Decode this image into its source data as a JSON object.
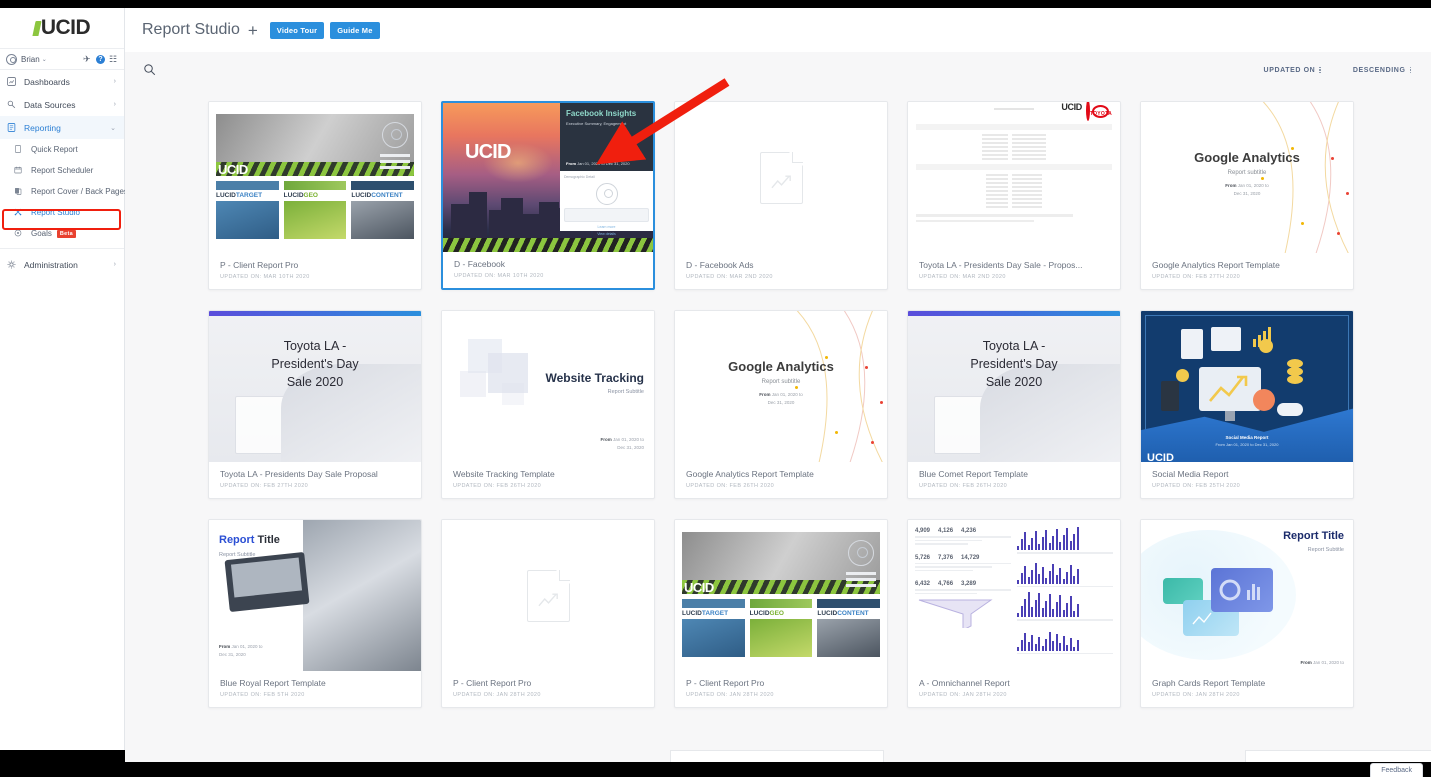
{
  "app": {
    "logo_text": "UCID",
    "logo_full": "LUCID"
  },
  "sidebar": {
    "user": {
      "name": "Brian",
      "caret": "⌄"
    },
    "icons": [
      {
        "name": "bell-icon",
        "glyph": "🔔"
      },
      {
        "name": "help-icon",
        "glyph": "?"
      },
      {
        "name": "apps-icon",
        "glyph": "⧉"
      }
    ],
    "items": [
      {
        "label": "Dashboards",
        "icon": "dashboard-icon",
        "chevron": "›",
        "active": false
      },
      {
        "label": "Data Sources",
        "icon": "data-sources-icon",
        "chevron": "›",
        "active": false
      },
      {
        "label": "Reporting",
        "icon": "reporting-icon",
        "chevron": "⌄",
        "active": true
      }
    ],
    "sub_items": [
      {
        "label": "Quick Report",
        "icon": "quick-report-icon"
      },
      {
        "label": "Report Scheduler",
        "icon": "calendar-icon"
      },
      {
        "label": "Report Cover / Back Pages",
        "icon": "cover-pages-icon"
      },
      {
        "label": "Report Studio",
        "icon": "report-studio-icon",
        "highlighted": true
      },
      {
        "label": "Goals",
        "icon": "goals-icon",
        "badge": "Beta"
      }
    ],
    "admin": {
      "label": "Administration",
      "icon": "gear-icon",
      "chevron": "›"
    }
  },
  "header": {
    "title": "Report Studio",
    "add_label": "+",
    "buttons": [
      {
        "label": "Video Tour",
        "name": "video-tour-button"
      },
      {
        "label": "Guide Me",
        "name": "guide-me-button"
      }
    ]
  },
  "toolbar": {
    "search_icon": "search-icon",
    "sort_by": "UPDATED ON",
    "sort_dir": "DESCENDING"
  },
  "cards": [
    {
      "title": "P - Client Report Pro",
      "date": "UPDATED ON: MAR 10TH 2020",
      "art": "client-report-pro",
      "selected": false
    },
    {
      "title": "D - Facebook",
      "date": "UPDATED ON: MAR 10TH 2020",
      "art": "facebook",
      "selected": true
    },
    {
      "title": "D - Facebook Ads",
      "date": "UPDATED ON: MAR 2ND 2020",
      "art": "blank-doc",
      "selected": false
    },
    {
      "title": "Toyota LA - Presidents Day Sale - Propos...",
      "date": "UPDATED ON: MAR 2ND 2020",
      "art": "toyota-doc",
      "selected": false
    },
    {
      "title": "Google Analytics Report Template",
      "date": "UPDATED ON: FEB 27TH 2020",
      "art": "google-analytics",
      "selected": false
    },
    {
      "title": "Toyota LA - Presidents Day Sale Proposal",
      "date": "UPDATED ON: FEB 27TH 2020",
      "art": "toyota-la",
      "selected": false
    },
    {
      "title": "Website Tracking Template",
      "date": "UPDATED ON: FEB 26TH 2020",
      "art": "website-tracking",
      "selected": false
    },
    {
      "title": "Google Analytics Report Template",
      "date": "UPDATED ON: FEB 26TH 2020",
      "art": "google-analytics",
      "selected": false
    },
    {
      "title": "Blue Comet Report Template",
      "date": "UPDATED ON: FEB 26TH 2020",
      "art": "toyota-la",
      "selected": false
    },
    {
      "title": "Social Media Report",
      "date": "UPDATED ON: FEB 25TH 2020",
      "art": "social-media",
      "selected": false
    },
    {
      "title": "Blue Royal Report Template",
      "date": "UPDATED ON: FEB 5TH 2020",
      "art": "blue-royal",
      "selected": false
    },
    {
      "title": "P - Client Report Pro",
      "date": "UPDATED ON: JAN 28TH 2020",
      "art": "blank-doc",
      "selected": false
    },
    {
      "title": "P - Client Report Pro",
      "date": "UPDATED ON: JAN 28TH 2020",
      "art": "client-report-pro",
      "selected": false
    },
    {
      "title": "A - Omnichannel Report",
      "date": "UPDATED ON: JAN 28TH 2020",
      "art": "omnichannel",
      "selected": false
    },
    {
      "title": "Graph Cards Report Template",
      "date": "UPDATED ON: JAN 28TH 2020",
      "art": "graph-cards",
      "selected": false
    }
  ],
  "thumb_text": {
    "facebook": {
      "logo": "UCID",
      "panel_title": "Facebook Insights",
      "panel_sub": "Executive Summary, Engagement",
      "panel_date": "From Jan 01, 2020 to Dec 31, 2020",
      "white_label": "Demographic Detail",
      "link1": "Learn more",
      "link2": "View details"
    },
    "google_analytics": {
      "title": "Google Analytics",
      "subtitle": "Report subtitle",
      "date1": "From Jan 01, 2020 to",
      "date2": "Dec 31, 2020"
    },
    "toyota_la": {
      "line1": "Toyota LA -",
      "line2": "President's Day",
      "line3": "Sale 2020"
    },
    "website_tracking": {
      "title": "Website Tracking",
      "subtitle": "Report Subtitle",
      "date1": "From Jan 01, 2020 to",
      "date2": "Dec 31, 2020"
    },
    "blue_royal": {
      "title_a": "Report",
      "title_b": "Title",
      "subtitle": "Report Subtitle",
      "date1": "From Jan 01, 2020 to",
      "date2": "Dec 31, 2020"
    },
    "graph_cards": {
      "title": "Report Title",
      "subtitle": "Report Subtitle",
      "date": "From Jan 01, 2020 to"
    },
    "social_media": {
      "title": "Social Media Report",
      "date": "From Jan 01, 2020 to Dec 31, 2020",
      "logo": "UCID"
    },
    "toyota_doc": {
      "lucid": "UCID",
      "toyota": "TOYOTA"
    },
    "client_report_pro": {
      "logo": "UCID",
      "label1_a": "LUCID",
      "label1_b": "TARGET",
      "label2_a": "LUCID",
      "label2_b": "GEO",
      "label3_a": "LUCID",
      "label3_b": "CONTENT"
    }
  },
  "footer": {
    "feedback_label": "Feedback"
  },
  "colors": {
    "accent": "#2b8fdd",
    "highlight_outline": "#f01f0e",
    "sidebar_active": "#2b7fd4",
    "lucid_green": "#8cc63f",
    "beta_badge": "#e8412f"
  }
}
